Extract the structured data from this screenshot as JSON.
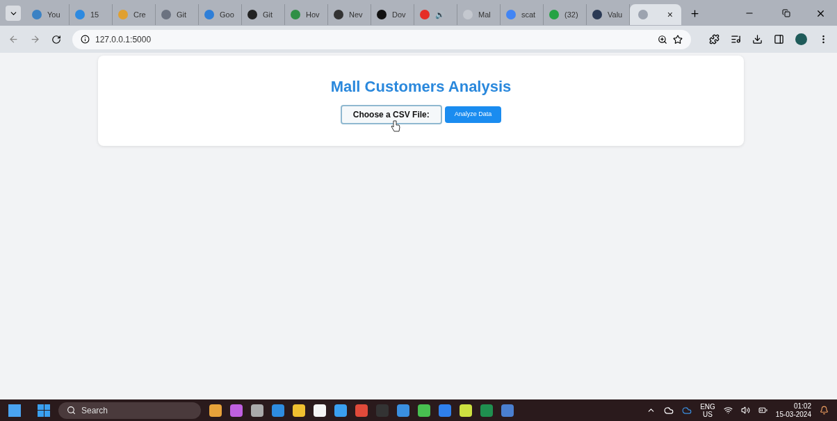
{
  "browser": {
    "tabs": [
      {
        "label": "You",
        "color": "#3b82c4",
        "selected": false
      },
      {
        "label": "15",
        "color": "#2d8ae0",
        "selected": false
      },
      {
        "label": "Cre",
        "color": "#e0a030",
        "selected": false
      },
      {
        "label": "Git",
        "color": "#6b7280",
        "selected": false
      },
      {
        "label": "Goo",
        "color": "#2f7fd8",
        "selected": false
      },
      {
        "label": "Git",
        "color": "#222222",
        "selected": false
      },
      {
        "label": "Hov",
        "color": "#2f8f46",
        "selected": false
      },
      {
        "label": "Nev",
        "color": "#333333",
        "selected": false
      },
      {
        "label": "Dov",
        "color": "#111111",
        "selected": false
      },
      {
        "label": "🔊",
        "color": "#e52d27",
        "selected": false
      },
      {
        "label": "Mal",
        "color": "#c4c8cf",
        "selected": false
      },
      {
        "label": "scat",
        "color": "#4285f4",
        "selected": false
      },
      {
        "label": "(32)",
        "color": "#25a244",
        "selected": false
      },
      {
        "label": "Valu",
        "color": "#2b3a55",
        "selected": false
      },
      {
        "label": "×",
        "color": "#9ca3af",
        "selected": true
      }
    ],
    "url": "127.0.0.1:5000"
  },
  "page": {
    "title": "Mall Customers Analysis",
    "file_button": "Choose a CSV File:",
    "submit_button": "Analyze Data"
  },
  "taskbar": {
    "search": "Search",
    "language": "ENG",
    "region": "US",
    "time": "01:02",
    "date": "15-03-2024"
  }
}
